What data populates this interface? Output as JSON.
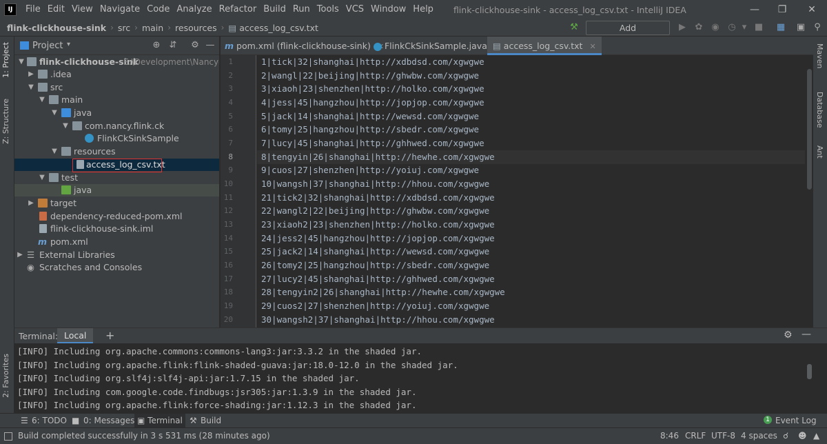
{
  "menubar": {
    "items": [
      "File",
      "Edit",
      "View",
      "Navigate",
      "Code",
      "Analyze",
      "Refactor",
      "Build",
      "Run",
      "Tools",
      "VCS",
      "Window",
      "Help"
    ],
    "window_title": "flink-clickhouse-sink - access_log_csv.txt - IntelliJ IDEA"
  },
  "navbar": {
    "crumbs": [
      "flink-clickhouse-sink",
      "src",
      "main",
      "resources",
      "access_log_csv.txt"
    ],
    "add_configuration": "Add Configuration..."
  },
  "left_strip": {
    "project_tab": "1: Project",
    "structure_tab": "Z: Structure",
    "favorites_tab": "2: Favorites"
  },
  "right_strip": {
    "maven": "Maven",
    "database": "Database",
    "ant": "Ant"
  },
  "project_panel": {
    "title": "Project",
    "tree": [
      {
        "label": "flink-clickhouse-sink",
        "path": "E:\\Development\\Nancyde"
      },
      {
        "label": ".idea"
      },
      {
        "label": "src"
      },
      {
        "label": "main"
      },
      {
        "label": "java"
      },
      {
        "label": "com.nancy.flink.ck"
      },
      {
        "label": "FlinkCkSinkSample"
      },
      {
        "label": "resources"
      },
      {
        "label": "access_log_csv.txt"
      },
      {
        "label": "test"
      },
      {
        "label": "java"
      },
      {
        "label": "target"
      },
      {
        "label": "dependency-reduced-pom.xml"
      },
      {
        "label": "flink-clickhouse-sink.iml"
      },
      {
        "label": "pom.xml"
      },
      {
        "label": "External Libraries"
      },
      {
        "label": "Scratches and Consoles"
      }
    ]
  },
  "editor": {
    "tabs": [
      {
        "label": "pom.xml (flink-clickhouse-sink)"
      },
      {
        "label": "FlinkCkSinkSample.java"
      },
      {
        "label": "access_log_csv.txt"
      }
    ],
    "line_numbers": [
      "1",
      "2",
      "3",
      "4",
      "5",
      "6",
      "7",
      "8",
      "9",
      "10",
      "11",
      "12",
      "13",
      "14",
      "15",
      "16",
      "17",
      "18",
      "19",
      "20"
    ],
    "lines": [
      "1|tick|32|shanghai|http://xdbdsd.com/xgwgwe",
      "2|wangl|22|beijing|http://ghwbw.com/xgwgwe",
      "3|xiaoh|23|shenzhen|http://holko.com/xgwgwe",
      "4|jess|45|hangzhou|http://jopjop.com/xgwgwe",
      "5|jack|14|shanghai|http://wewsd.com/xgwgwe",
      "6|tomy|25|hangzhou|http://sbedr.com/xgwgwe",
      "7|lucy|45|shanghai|http://ghhwed.com/xgwgwe",
      "8|tengyin|26|shanghai|http://hewhe.com/xgwgwe",
      "9|cuos|27|shenzhen|http://yoiuj.com/xgwgwe",
      "10|wangsh|37|shanghai|http://hhou.com/xgwgwe",
      "21|tick2|32|shanghai|http://xdbdsd.com/xgwgwe",
      "22|wangl2|22|beijing|http://ghwbw.com/xgwgwe",
      "23|xiaoh2|23|shenzhen|http://holko.com/xgwgwe",
      "24|jess2|45|hangzhou|http://jopjop.com/xgwgwe",
      "25|jack2|14|shanghai|http://wewsd.com/xgwgwe",
      "26|tomy2|25|hangzhou|http://sbedr.com/xgwgwe",
      "27|lucy2|45|shanghai|http://ghhwed.com/xgwgwe",
      "28|tengyin2|26|shanghai|http://hewhe.com/xgwgwe",
      "29|cuos2|27|shenzhen|http://yoiuj.com/xgwgwe",
      "30|wangsh2|37|shanghai|http://hhou.com/xgwgwe"
    ]
  },
  "terminal": {
    "label": "Terminal:",
    "tab": "Local",
    "add": "+",
    "lines": [
      "[INFO] Including org.apache.commons:commons-lang3:jar:3.3.2 in the shaded jar.",
      "[INFO] Including org.apache.flink:flink-shaded-guava:jar:18.0-12.0 in the shaded jar.",
      "[INFO] Including org.slf4j:slf4j-api:jar:1.7.15 in the shaded jar.",
      "[INFO] Including com.google.code.findbugs:jsr305:jar:1.3.9 in the shaded jar.",
      "[INFO] Including org.apache.flink:force-shading:jar:1.12.3 in the shaded jar."
    ]
  },
  "tool_windows": {
    "todo": "6: TODO",
    "messages": "0: Messages",
    "terminal": "Terminal",
    "build": "Build",
    "event_log": "Event Log",
    "event_count": "1"
  },
  "status": {
    "message": "Build completed successfully in 3 s 531 ms (28 minutes ago)",
    "position": "8:46",
    "line_sep": "CRLF",
    "encoding": "UTF-8",
    "indent": "4 spaces"
  }
}
